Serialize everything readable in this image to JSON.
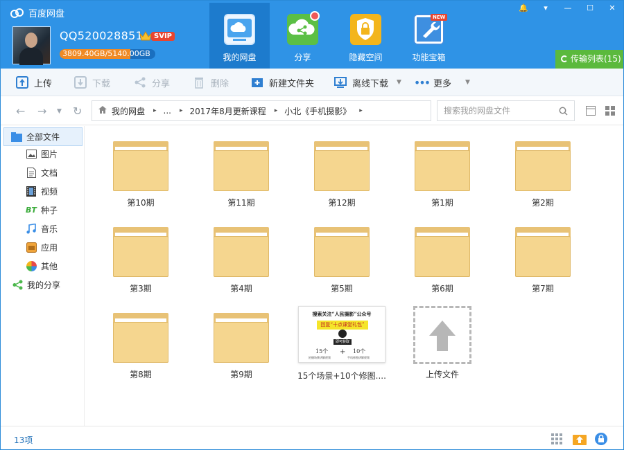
{
  "app": {
    "title": "百度网盘"
  },
  "user": {
    "name": "QQ520028851",
    "vip_badge": "SVIP",
    "quota_used": "3809.40GB",
    "quota_total": "5140.00GB",
    "quota_fraction": 0.741
  },
  "nav": [
    {
      "label": "我的网盘",
      "icon": "cloud-icon",
      "active": true
    },
    {
      "label": "分享",
      "icon": "share-icon",
      "active": false,
      "dot": true
    },
    {
      "label": "隐藏空间",
      "icon": "lock-icon",
      "active": false
    },
    {
      "label": "功能宝箱",
      "icon": "wrench-icon",
      "active": false,
      "badge": "NEW"
    }
  ],
  "transfer": {
    "label": "传输列表(15)"
  },
  "toolbar": {
    "upload": "上传",
    "download": "下载",
    "share": "分享",
    "delete": "删除",
    "new_folder": "新建文件夹",
    "offline_download": "离线下载",
    "more": "更多"
  },
  "breadcrumb": {
    "root": "我的网盘",
    "ellipsis": "...",
    "items": [
      "2017年8月更新课程",
      "小北《手机摄影》"
    ]
  },
  "search": {
    "placeholder": "搜索我的网盘文件"
  },
  "sidebar": [
    {
      "label": "全部文件",
      "icon": "all-files-icon"
    },
    {
      "label": "图片",
      "icon": "picture-icon"
    },
    {
      "label": "文档",
      "icon": "document-icon"
    },
    {
      "label": "视频",
      "icon": "video-icon"
    },
    {
      "label": "种子",
      "icon": "torrent-icon",
      "icon_text": "BT"
    },
    {
      "label": "音乐",
      "icon": "music-icon"
    },
    {
      "label": "应用",
      "icon": "app-icon"
    },
    {
      "label": "其他",
      "icon": "other-icon"
    },
    {
      "label": "我的分享",
      "icon": "my-share-icon"
    }
  ],
  "files": [
    {
      "name": "第10期",
      "type": "folder"
    },
    {
      "name": "第11期",
      "type": "folder"
    },
    {
      "name": "第12期",
      "type": "folder"
    },
    {
      "name": "第1期",
      "type": "folder"
    },
    {
      "name": "第2期",
      "type": "folder"
    },
    {
      "name": "第3期",
      "type": "folder"
    },
    {
      "name": "第4期",
      "type": "folder"
    },
    {
      "name": "第5期",
      "type": "folder"
    },
    {
      "name": "第6期",
      "type": "folder"
    },
    {
      "name": "第7期",
      "type": "folder"
    },
    {
      "name": "第8期",
      "type": "folder"
    },
    {
      "name": "第9期",
      "type": "folder"
    },
    {
      "name": "15个场景+10个修图....",
      "type": "image"
    }
  ],
  "thumbnail": {
    "line1": "搜索关注“人民摄影”公众号",
    "line2": "回复“十点课堂礼包”",
    "button": "即可获取",
    "num_left": "15个",
    "sub_left": "拍摄场景讲解视频",
    "plus": "+",
    "num_right": "10个",
    "sub_right": "手机修图讲解视频"
  },
  "upload_tile": {
    "label": "上传文件"
  },
  "status": {
    "count": "13项"
  },
  "colors": {
    "header": "#2f93e6",
    "folder": "#f5d68f",
    "transfer": "#5bb93d",
    "svip": "#e8452f"
  }
}
